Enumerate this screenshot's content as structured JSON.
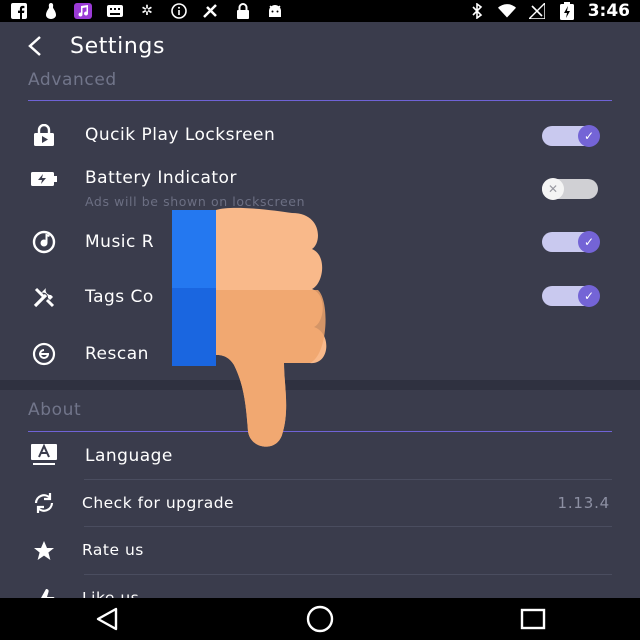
{
  "status_bar": {
    "time": "3:46",
    "icons": [
      "facebook-icon",
      "bowling-pin-icon",
      "music-app-icon",
      "keyboard-icon",
      "settings-icon",
      "info-icon",
      "game-icon",
      "lock-icon",
      "android-icon",
      "bluetooth-icon",
      "wifi-icon",
      "no-signal-icon",
      "battery-charging-icon"
    ]
  },
  "header": {
    "title": "Settings"
  },
  "advanced": {
    "label": "Advanced",
    "items": [
      {
        "label": "Qucik Play Locksreen",
        "icon": "lock-play-icon",
        "toggle": true
      },
      {
        "label": "Battery Indicator",
        "subtitle": "Ads will be shown on lockscreen",
        "icon": "battery-icon",
        "toggle": false
      },
      {
        "label": "Music R",
        "icon": "music-disc-icon",
        "toggle": true
      },
      {
        "label": "Tags Co",
        "icon": "tools-icon",
        "toggle": true
      },
      {
        "label": "Rescan",
        "icon": "rescan-icon"
      }
    ]
  },
  "about": {
    "label": "About",
    "items": [
      {
        "label": "Language",
        "icon": "language-icon"
      },
      {
        "label": "Check for upgrade",
        "icon": "refresh-icon",
        "value": "1.13.4"
      },
      {
        "label": "Rate us",
        "icon": "star-icon"
      },
      {
        "label": "Like us",
        "icon": "thumb-up-icon"
      }
    ]
  },
  "colors": {
    "background": "#3a3c4c",
    "accent": "#7464d6",
    "divider": "#6f63d6"
  },
  "overlay": {
    "icon": "thumbs-down-icon"
  }
}
